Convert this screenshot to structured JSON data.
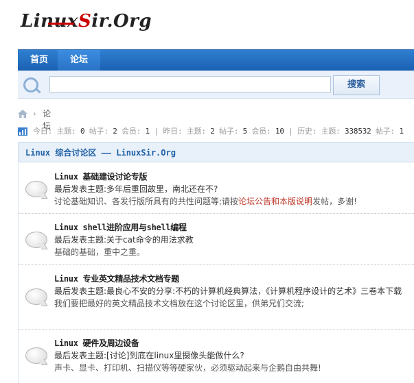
{
  "logo": {
    "text_a": "Linux",
    "text_s": "S",
    "text_b": "ir.Org"
  },
  "nav": {
    "items": [
      {
        "label": "首页"
      },
      {
        "label": "论坛"
      }
    ]
  },
  "search": {
    "placeholder": "",
    "value": "",
    "button_label": "搜索"
  },
  "breadcrumb": {
    "separator": "›",
    "label": "论坛"
  },
  "stats": {
    "today_label": "今日:",
    "topics_label": "主题:",
    "posts_label": "帖子:",
    "members_label": "会员:",
    "yesterday_label": "昨日:",
    "history_label": "历史:",
    "today": {
      "topics": "0",
      "posts": "2",
      "members": "1"
    },
    "yesterday": {
      "topics": "2",
      "posts": "5",
      "members": "10"
    },
    "history": {
      "topics": "338532",
      "posts": "1"
    }
  },
  "section": {
    "title": "Linux 综合讨论区 —— LinuxSir.Org"
  },
  "forums": [
    {
      "title": "Linux 基础建设讨论专版",
      "latest": "最后发表主题:多年后重回故里，南北还在不?",
      "desc_pre": "讨论基础知识、各发行版所具有的共性问题等;请按",
      "desc_hl": "论坛公告和本版说明",
      "desc_post": "发帖，多谢!"
    },
    {
      "title": "Linux shell进阶应用与shell编程",
      "latest": "最后发表主题:关于cat命令的用法求教",
      "desc_pre": "基础的基础，重中之重。",
      "desc_hl": "",
      "desc_post": ""
    },
    {
      "title": "Linux 专业英文精品技术文档专题",
      "latest": "最后发表主题:最良心不安的分享:不朽的计算机经典算法，《计算机程序设计的艺术》三卷本下载",
      "desc_pre": "我们要把最好的英文精品技术文档放在这个讨论区里，供弟兄们交流;",
      "desc_hl": "",
      "desc_post": ""
    },
    {
      "title": "Linux 硬件及周边设备",
      "latest": "最后发表主题:[讨论]到底在linux里摄像头能做什么?",
      "desc_pre": "声卡、显卡、打印机、扫描仪等等硬家伙，必须驱动起来与企鹅自由共舞!",
      "desc_hl": "",
      "desc_post": ""
    }
  ]
}
